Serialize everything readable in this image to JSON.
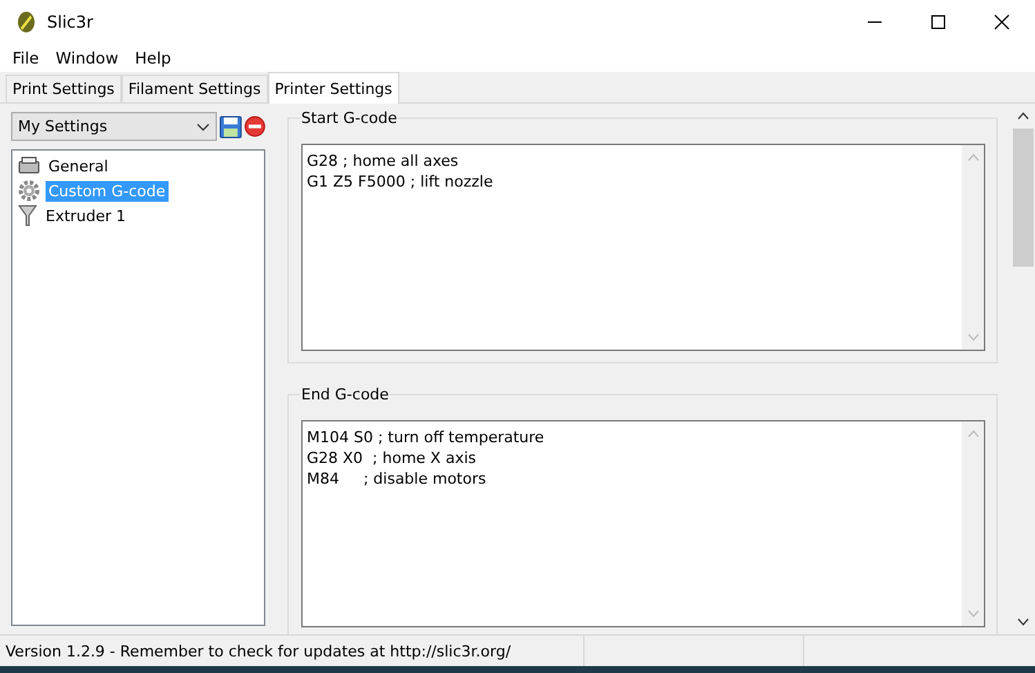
{
  "window": {
    "title": "Slic3r"
  },
  "menu": [
    "File",
    "Window",
    "Help"
  ],
  "tabs": [
    {
      "label": "Print Settings",
      "selected": false
    },
    {
      "label": "Filament Settings",
      "selected": false
    },
    {
      "label": "Printer Settings",
      "selected": true
    }
  ],
  "preset": {
    "value": "My Settings"
  },
  "tree": [
    {
      "label": "General",
      "kind": "printer",
      "selected": false
    },
    {
      "label": "Custom G-code",
      "kind": "gear",
      "selected": true
    },
    {
      "label": "Extruder 1",
      "kind": "funnel",
      "selected": false
    }
  ],
  "groups": [
    {
      "title": "Start G-code",
      "value": "G28 ; home all axes\nG1 Z5 F5000 ; lift nozzle"
    },
    {
      "title": "End G-code",
      "value": "M104 S0 ; turn off temperature\nG28 X0  ; home X axis\nM84     ; disable motors"
    }
  ],
  "status_bar": {
    "text": "Version 1.2.9 - Remember to check for updates at http://slic3r.org/"
  }
}
